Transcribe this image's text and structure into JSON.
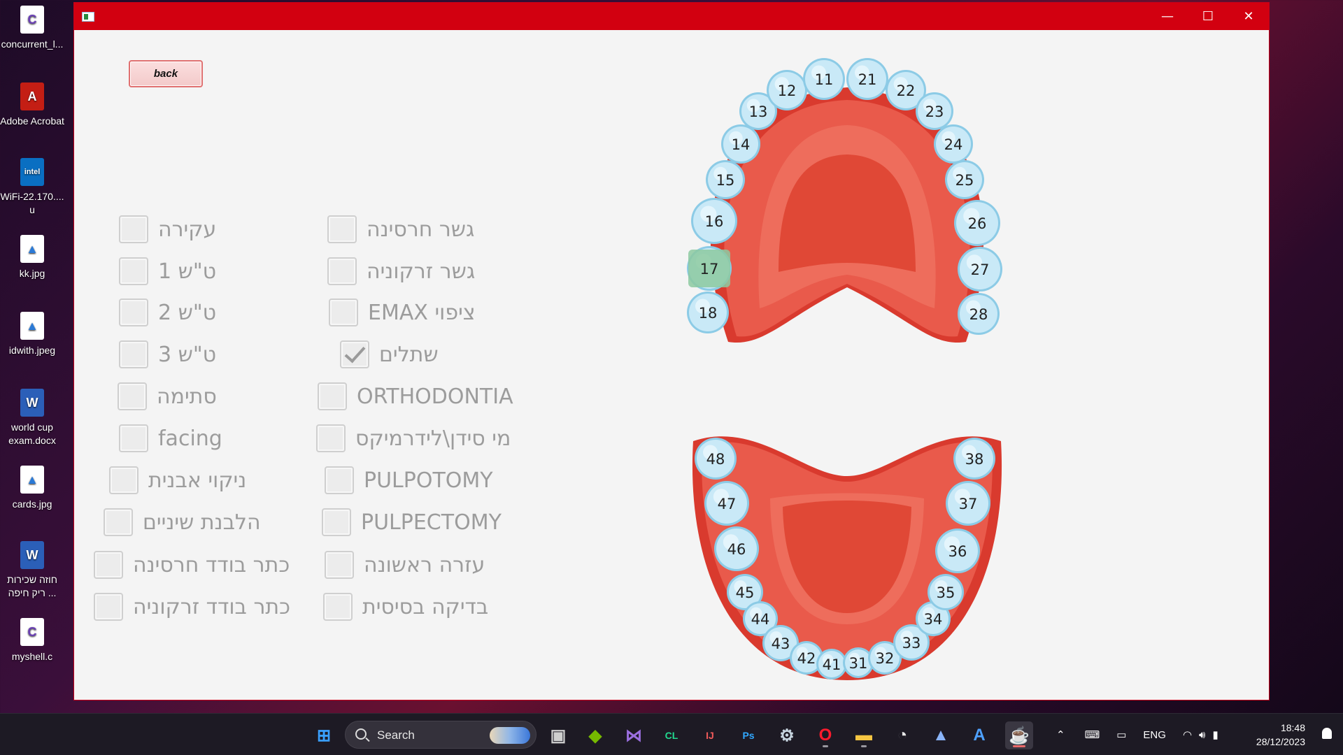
{
  "desktop": {
    "icons": [
      {
        "label": "concurrent_l...",
        "icon": "c-source-file-icon"
      },
      {
        "label": "Adobe Acrobat",
        "icon": "adobe-acrobat-icon"
      },
      {
        "label": "WiFi-22.170.... u",
        "icon": "intel-wifi-installer-icon"
      },
      {
        "label": "kk.jpg",
        "icon": "image-file-icon"
      },
      {
        "label": "idwith.jpeg",
        "icon": "image-file-icon"
      },
      {
        "label": "world cup exam.docx",
        "icon": "word-document-icon"
      },
      {
        "label": "cards.jpg",
        "icon": "image-file-icon"
      },
      {
        "label": "חוזה שכירות ריק חיפה ...",
        "icon": "word-document-icon"
      },
      {
        "label": "myshell.c",
        "icon": "c-source-file-icon"
      }
    ]
  },
  "window": {
    "controls": {
      "minimize": "—",
      "maximize": "☐",
      "close": "✕"
    },
    "back_label": "back",
    "accent": "#d20010",
    "left_options": [
      {
        "label": "עקירה",
        "checked": false
      },
      {
        "label": "ט\"ש 1",
        "checked": false
      },
      {
        "label": "ט\"ש 2",
        "checked": false
      },
      {
        "label": "ט\"ש 3",
        "checked": false
      },
      {
        "label": "סתימה",
        "checked": false
      },
      {
        "label": "facing",
        "checked": false
      },
      {
        "label": "ניקוי אבנית",
        "checked": false
      },
      {
        "label": "הלבנת שיניים",
        "checked": false
      },
      {
        "label": "כתר בודד חרסינה",
        "checked": false
      },
      {
        "label": "כתר בודד זרקוניה",
        "checked": false
      }
    ],
    "right_options": [
      {
        "label": "גשר חרסינה",
        "checked": false
      },
      {
        "label": "גשר זרקוניה",
        "checked": false
      },
      {
        "label": "ציפוי EMAX",
        "checked": false
      },
      {
        "label": "שתלים",
        "checked": true
      },
      {
        "label": "ORTHODONTIA",
        "checked": false
      },
      {
        "label": "מי סידן\\לידרמיקס",
        "checked": false
      },
      {
        "label": "PULPOTOMY",
        "checked": false
      },
      {
        "label": "PULPECTOMY",
        "checked": false
      },
      {
        "label": "עזרה ראשונה",
        "checked": false
      },
      {
        "label": "בדיקה בסיסית",
        "checked": false
      }
    ],
    "upper_teeth": [
      "18",
      "17",
      "16",
      "15",
      "14",
      "13",
      "12",
      "11",
      "21",
      "22",
      "23",
      "24",
      "25",
      "26",
      "27",
      "28"
    ],
    "lower_teeth": [
      "48",
      "47",
      "46",
      "45",
      "44",
      "43",
      "42",
      "41",
      "31",
      "32",
      "33",
      "34",
      "35",
      "36",
      "37",
      "38"
    ],
    "selected_tooth": "17",
    "colors": {
      "gum": "#e95a4b",
      "gum_dark": "#d93a2e",
      "palate": "#e04836",
      "tooth": "#c9e9f7",
      "tooth_edge": "#8ccbe6",
      "selected": "#8cc9a0"
    }
  },
  "taskbar": {
    "search_placeholder": "Search",
    "apps": [
      "windows-start-icon",
      "task-view-icon",
      "nvidia-icon",
      "visual-studio-icon",
      "clion-icon",
      "intellij-icon",
      "photoshop-icon",
      "steam-icon",
      "opera-icon",
      "file-explorer-icon",
      "clock-app-icon",
      "chart-app-icon",
      "ai-assistant-icon",
      "java-app-icon"
    ],
    "language": "ENG",
    "time": "18:48",
    "date": "28/12/2023"
  }
}
